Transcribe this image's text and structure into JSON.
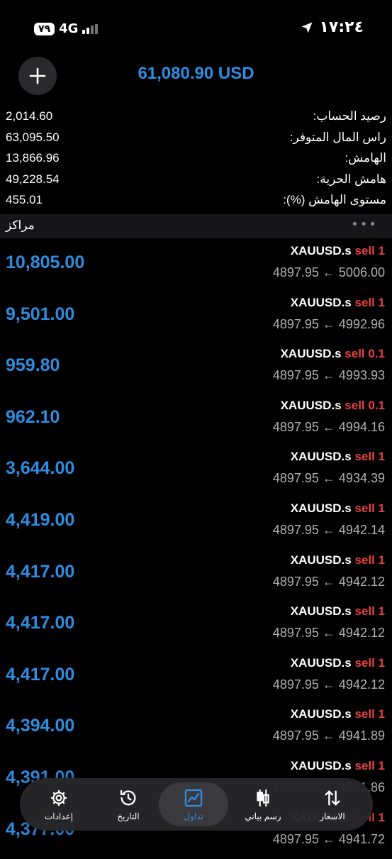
{
  "status_bar": {
    "battery": "٧٩",
    "network": "4G",
    "time": "١٧:٢٤"
  },
  "header": {
    "equity": "61,080.90 USD"
  },
  "summary": [
    {
      "label": "رصيد الحساب:",
      "value": "2,014.60"
    },
    {
      "label": "راس المال المتوفر:",
      "value": "63,095.50"
    },
    {
      "label": "الهامش:",
      "value": "13,866.96"
    },
    {
      "label": "هامش الحرية:",
      "value": "49,228.54"
    },
    {
      "label": "مستوى الهامش (%):",
      "value": "455.01"
    }
  ],
  "section": {
    "title": "مراكز",
    "more": "•••"
  },
  "positions": [
    {
      "symbol": "XAUUSD.s",
      "side": "sell 1",
      "open": "5006.00",
      "current": "4897.95",
      "profit": "10,805.00"
    },
    {
      "symbol": "XAUUSD.s",
      "side": "sell 1",
      "open": "4992.96",
      "current": "4897.95",
      "profit": "9,501.00"
    },
    {
      "symbol": "XAUUSD.s",
      "side": "sell 0.1",
      "open": "4993.93",
      "current": "4897.95",
      "profit": "959.80"
    },
    {
      "symbol": "XAUUSD.s",
      "side": "sell 0.1",
      "open": "4994.16",
      "current": "4897.95",
      "profit": "962.10"
    },
    {
      "symbol": "XAUUSD.s",
      "side": "sell 1",
      "open": "4934.39",
      "current": "4897.95",
      "profit": "3,644.00"
    },
    {
      "symbol": "XAUUSD.s",
      "side": "sell 1",
      "open": "4942.14",
      "current": "4897.95",
      "profit": "4,419.00"
    },
    {
      "symbol": "XAUUSD.s",
      "side": "sell 1",
      "open": "4942.12",
      "current": "4897.95",
      "profit": "4,417.00"
    },
    {
      "symbol": "XAUUSD.s",
      "side": "sell 1",
      "open": "4942.12",
      "current": "4897.95",
      "profit": "4,417.00"
    },
    {
      "symbol": "XAUUSD.s",
      "side": "sell 1",
      "open": "4942.12",
      "current": "4897.95",
      "profit": "4,417.00"
    },
    {
      "symbol": "XAUUSD.s",
      "side": "sell 1",
      "open": "4941.89",
      "current": "4897.95",
      "profit": "4,394.00"
    },
    {
      "symbol": "XAUUSD.s",
      "side": "sell 1",
      "open": "4941.86",
      "current": "4897.95",
      "profit": "4,391.00"
    },
    {
      "symbol": "XAUUSD.s",
      "side": "sell 1",
      "open": "4941.72",
      "current": "4897.95",
      "profit": "4,377.00"
    }
  ],
  "tabbar": [
    {
      "label": "الاسعار",
      "icon": "arrows-updown-icon"
    },
    {
      "label": "رسم بياني",
      "icon": "candlestick-icon"
    },
    {
      "label": "تداول",
      "icon": "trade-chart-icon",
      "active": true
    },
    {
      "label": "التاريخ",
      "icon": "history-icon"
    },
    {
      "label": "إعدادات",
      "icon": "gear-icon"
    }
  ],
  "colors": {
    "accent": "#2e8de0",
    "sell": "#e84040",
    "background": "#000000"
  }
}
